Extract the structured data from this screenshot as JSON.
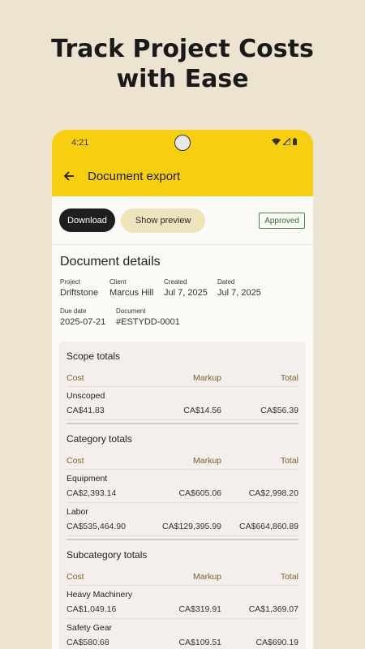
{
  "headline": {
    "line1": "Track Project Costs",
    "line2": "with Ease"
  },
  "status_bar": {
    "time": "4:21"
  },
  "app_bar": {
    "title": "Document export"
  },
  "actions": {
    "download": "Download",
    "preview": "Show preview",
    "status": "Approved"
  },
  "details": {
    "title": "Document details",
    "project_label": "Project",
    "project": "Driftstone",
    "client_label": "Client",
    "client": "Marcus Hill",
    "created_label": "Created",
    "created": "Jul 7, 2025",
    "dated_label": "Dated",
    "dated": "Jul 7, 2025",
    "due_label": "Due date",
    "due": "2025-07-21",
    "doc_label": "Document",
    "doc": "#ESTYDD-0001"
  },
  "columns": {
    "cost": "Cost",
    "markup": "Markup",
    "total": "Total"
  },
  "scope_totals": {
    "title": "Scope totals",
    "rows": [
      {
        "name": "Unscoped",
        "cost": "CA$41.83",
        "markup": "CA$14.56",
        "total": "CA$56.39"
      }
    ]
  },
  "category_totals": {
    "title": "Category totals",
    "rows": [
      {
        "name": "Equipment",
        "cost": "CA$2,393.14",
        "markup": "CA$605.06",
        "total": "CA$2,998.20"
      },
      {
        "name": "Labor",
        "cost": "CA$535,464.90",
        "markup": "CA$129,395.99",
        "total": "CA$664,860.89"
      }
    ]
  },
  "subcategory_totals": {
    "title": "Subcategory totals",
    "rows": [
      {
        "name": "Heavy Machinery",
        "cost": "CA$1,049.16",
        "markup": "CA$319.91",
        "total": "CA$1,369.07"
      },
      {
        "name": "Safety Gear",
        "cost": "CA$580.68",
        "markup": "CA$109.51",
        "total": "CA$690.19"
      }
    ]
  },
  "colors": {
    "accent": "#f7cf0f",
    "background": "#ece3d0",
    "approved": "#3b8a3a"
  }
}
